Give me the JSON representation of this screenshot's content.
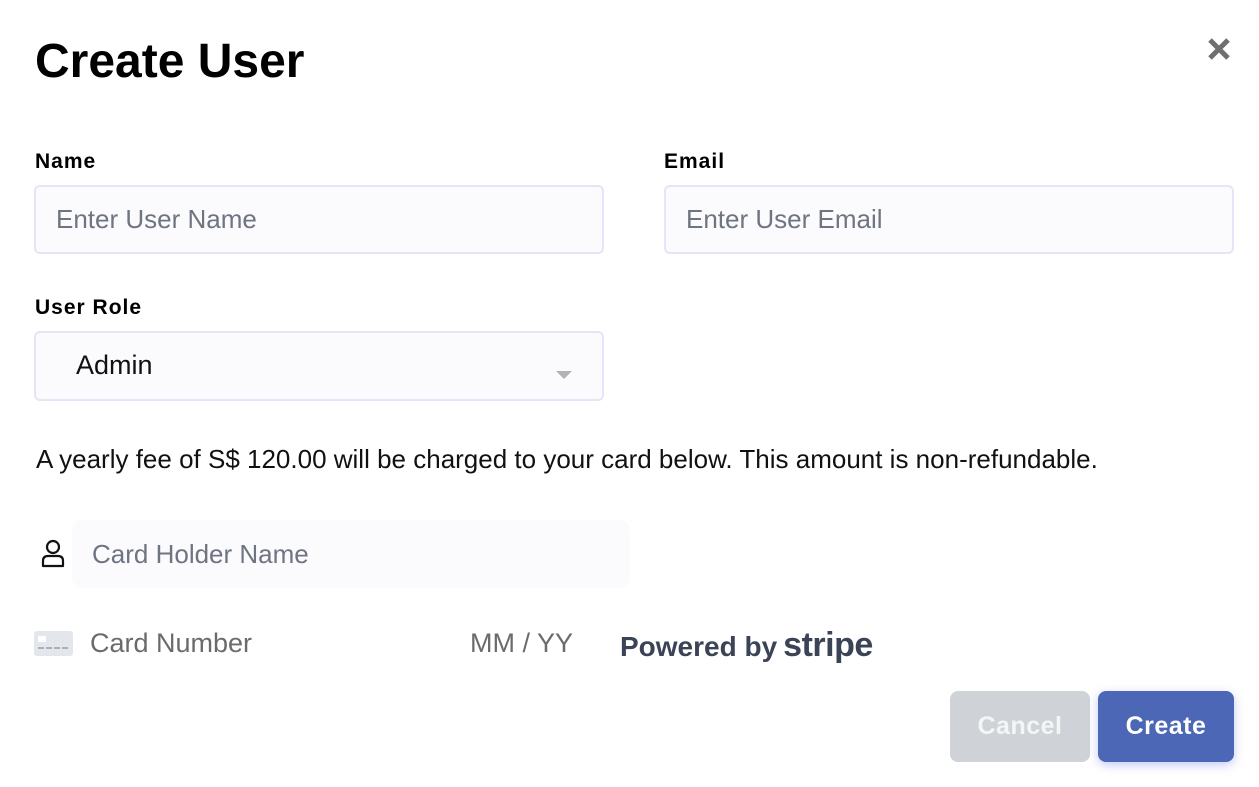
{
  "dialog": {
    "title": "Create User",
    "close_icon": "close-icon"
  },
  "form": {
    "name": {
      "label": "Name",
      "placeholder": "Enter User Name",
      "value": ""
    },
    "email": {
      "label": "Email",
      "placeholder": "Enter User Email",
      "value": ""
    },
    "role": {
      "label": "User Role",
      "selected": "Admin",
      "icon": "chevron-down-icon"
    }
  },
  "payment": {
    "notice": "A yearly fee of S$ 120.00 will be charged to your card below. This amount is non-refundable.",
    "card_holder": {
      "placeholder": "Card Holder Name",
      "icon": "user-icon"
    },
    "card_number": {
      "placeholder": "Card Number",
      "icon": "credit-card-icon"
    },
    "expiry": {
      "placeholder": "MM / YY"
    },
    "powered_by": {
      "prefix": "Powered by",
      "brand": "stripe"
    }
  },
  "actions": {
    "cancel_label": "Cancel",
    "create_label": "Create"
  },
  "colors": {
    "primary": "#4b67b5",
    "cancel": "#cfd3d8",
    "input_border": "#e4e5f8",
    "input_bg": "#fbfbfe"
  }
}
